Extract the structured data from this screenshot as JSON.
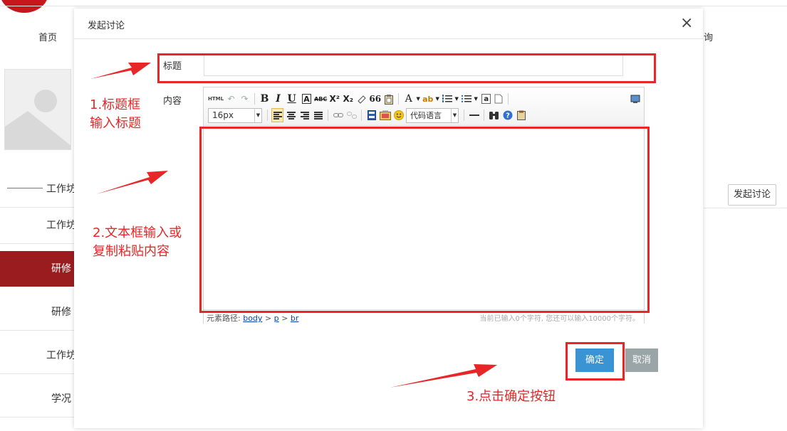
{
  "background": {
    "nav": {
      "home": "首页",
      "right_fragment": "询"
    },
    "section_title": "工作坊",
    "sidebar_items": [
      {
        "label": "工作坊"
      },
      {
        "label": "研修"
      },
      {
        "label": "研修"
      },
      {
        "label": "工作坊"
      },
      {
        "label": "学况"
      }
    ],
    "start_discussion_button": "发起讨论"
  },
  "modal": {
    "title": "发起讨论",
    "close_glyph": "×",
    "title_field_label": "标题",
    "title_field_value": "",
    "content_field_label": "内容",
    "editor": {
      "toolbar_row1": {
        "html": "HTML",
        "bold": "B",
        "italic": "I",
        "underline": "U",
        "border": "A",
        "strike": "ABC",
        "superscript": "X²",
        "subscript": "X₂",
        "quote": "66",
        "font_color": "A",
        "unordered_marker": "☰",
        "anchor": "a"
      },
      "font_size": "16px",
      "code_language": "代码语言",
      "status_path_label": "元素路径:",
      "status_path": [
        "body",
        "p",
        "br"
      ],
      "status_path_sep": ">",
      "char_count": "当前已输入0个字符, 您还可以输入10000个字符。"
    },
    "ok_button": "确定",
    "cancel_button": "取消"
  },
  "annotations": {
    "step1": "1.标题框\n输入标题",
    "step1_line1": "1.标题框",
    "step1_line2": "输入标题",
    "step2_line1": "2.文本框输入或",
    "step2_line2": "复制粘贴内容",
    "step3": "3.点击确定按钮",
    "color": "#e62627"
  }
}
